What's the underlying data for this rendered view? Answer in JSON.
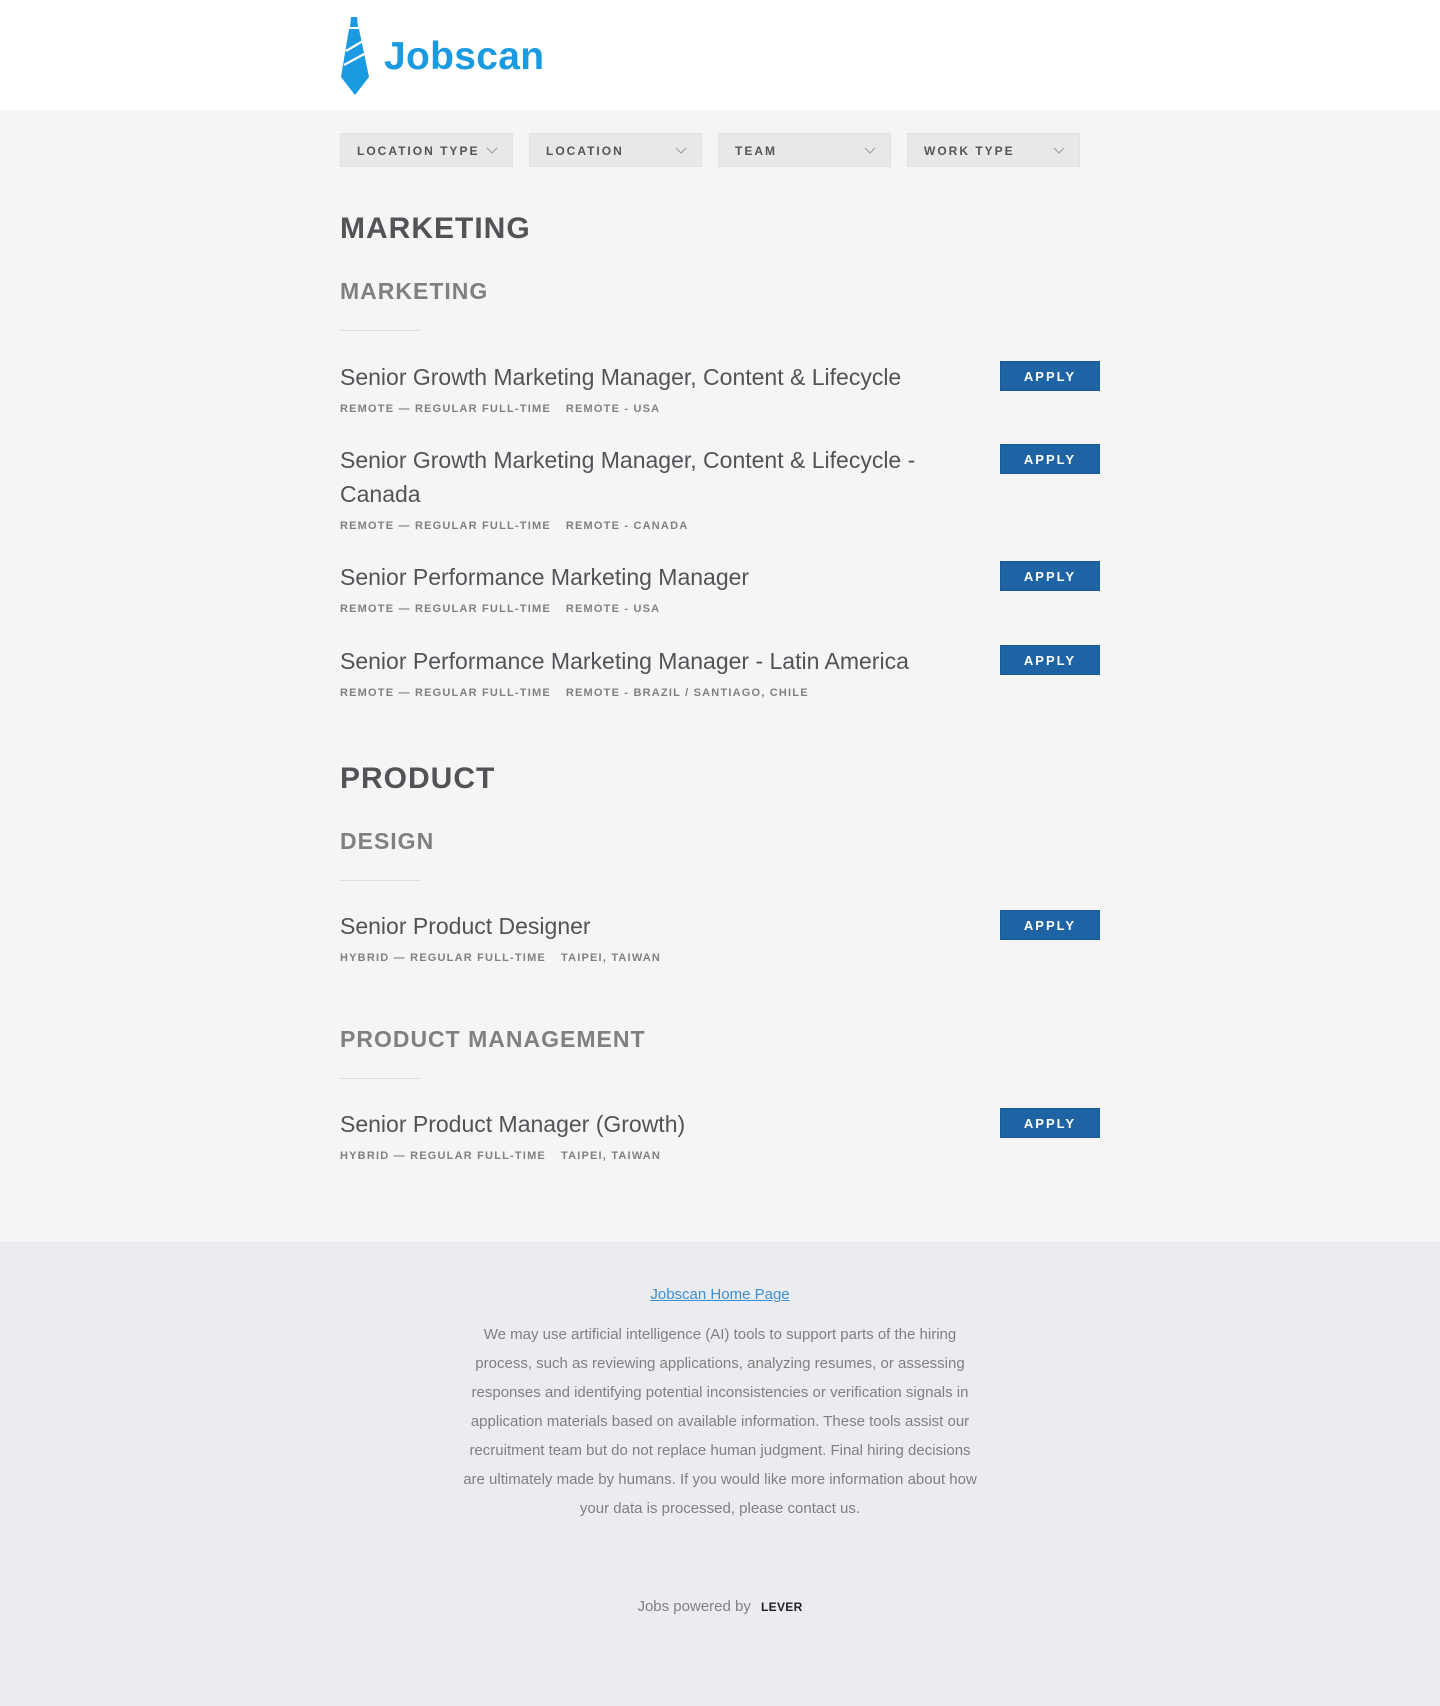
{
  "header": {
    "logo_text": "Jobscan",
    "brand_color": "#1a9ae0"
  },
  "filters": [
    {
      "label": "LOCATION TYPE"
    },
    {
      "label": "LOCATION"
    },
    {
      "label": "TEAM"
    },
    {
      "label": "WORK TYPE"
    }
  ],
  "departments": [
    {
      "name": "MARKETING",
      "teams": [
        {
          "name": "MARKETING",
          "postings": [
            {
              "title": "Senior Growth Marketing Manager, Content & Lifecycle",
              "commitment": "REMOTE — REGULAR FULL-TIME",
              "location": "REMOTE - USA",
              "apply": "APPLY"
            },
            {
              "title": "Senior Growth Marketing Manager, Content & Lifecycle - Canada",
              "commitment": "REMOTE — REGULAR FULL-TIME",
              "location": "REMOTE - CANADA",
              "apply": "APPLY"
            },
            {
              "title": "Senior Performance Marketing Manager",
              "commitment": "REMOTE — REGULAR FULL-TIME",
              "location": "REMOTE - USA",
              "apply": "APPLY"
            },
            {
              "title": "Senior Performance Marketing Manager - Latin America",
              "commitment": "REMOTE — REGULAR FULL-TIME",
              "location": "REMOTE - BRAZIL / SANTIAGO, CHILE",
              "apply": "APPLY"
            }
          ]
        }
      ]
    },
    {
      "name": "PRODUCT",
      "teams": [
        {
          "name": "DESIGN",
          "postings": [
            {
              "title": "Senior Product Designer",
              "commitment": "HYBRID — REGULAR FULL-TIME",
              "location": "TAIPEI, TAIWAN",
              "apply": "APPLY"
            }
          ]
        },
        {
          "name": "PRODUCT MANAGEMENT",
          "postings": [
            {
              "title": "Senior Product Manager (Growth)",
              "commitment": "HYBRID — REGULAR FULL-TIME",
              "location": "TAIPEI, TAIWAN",
              "apply": "APPLY"
            }
          ]
        }
      ]
    }
  ],
  "footer": {
    "home_link": "Jobscan Home Page",
    "disclaimer": "We may use artificial intelligence (AI) tools to support parts of the hiring process, such as reviewing applications, analyzing resumes, or assessing responses and identifying potential inconsistencies or verification signals in application materials based on available information. These tools assist our recruitment team but do not replace human judgment. Final hiring decisions are ultimately made by humans. If you would like more information about how your data is processed, please contact us.",
    "powered_by": "Jobs powered by",
    "lever_logo": "LEVER"
  },
  "colors": {
    "apply_button": "#1e63a3",
    "page_bg": "#f5f5f6",
    "footer_bg": "#ebecf0",
    "link": "#3c8fd4"
  }
}
